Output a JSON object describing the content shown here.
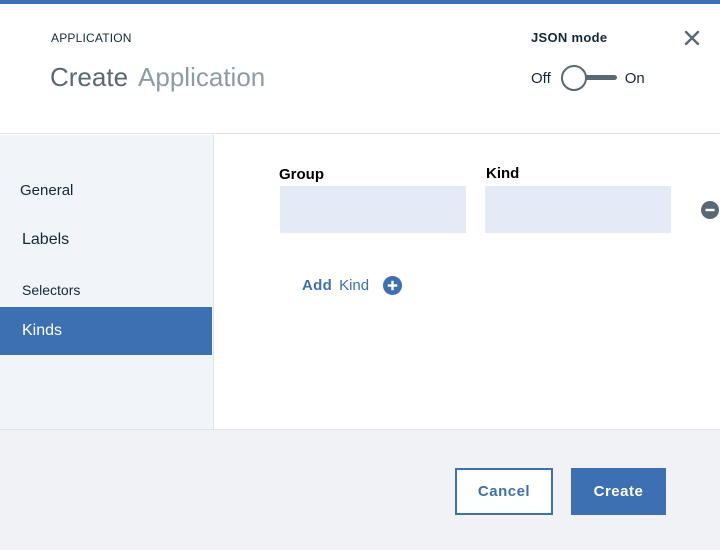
{
  "header": {
    "app_label": "APPLICATION",
    "title_action": "Create",
    "title_type": "Application",
    "json_mode": {
      "label": "JSON mode",
      "off_label": "Off",
      "on_label": "On",
      "state": "off"
    },
    "close_icon": "close-icon"
  },
  "sidebar": {
    "items": [
      {
        "label": "General",
        "selected": false
      },
      {
        "label": "Labels",
        "selected": false
      },
      {
        "label": "Selectors",
        "selected": false
      },
      {
        "label": "Kinds",
        "selected": true
      }
    ]
  },
  "kinds_form": {
    "group_label": "Group",
    "group_value": "",
    "kind_label": "Kind",
    "kind_value": "",
    "remove_icon": "minus-circle-icon",
    "add_label_bold": "Add",
    "add_label": "Kind",
    "add_icon": "plus-circle-icon"
  },
  "footer": {
    "cancel_label": "Cancel",
    "create_label": "Create"
  },
  "colors": {
    "accent": "#3d70b2",
    "input_bg": "#e4ebf6",
    "sidebar_bg": "#f1f4f9",
    "footer_bg": "#f0f2f5"
  }
}
